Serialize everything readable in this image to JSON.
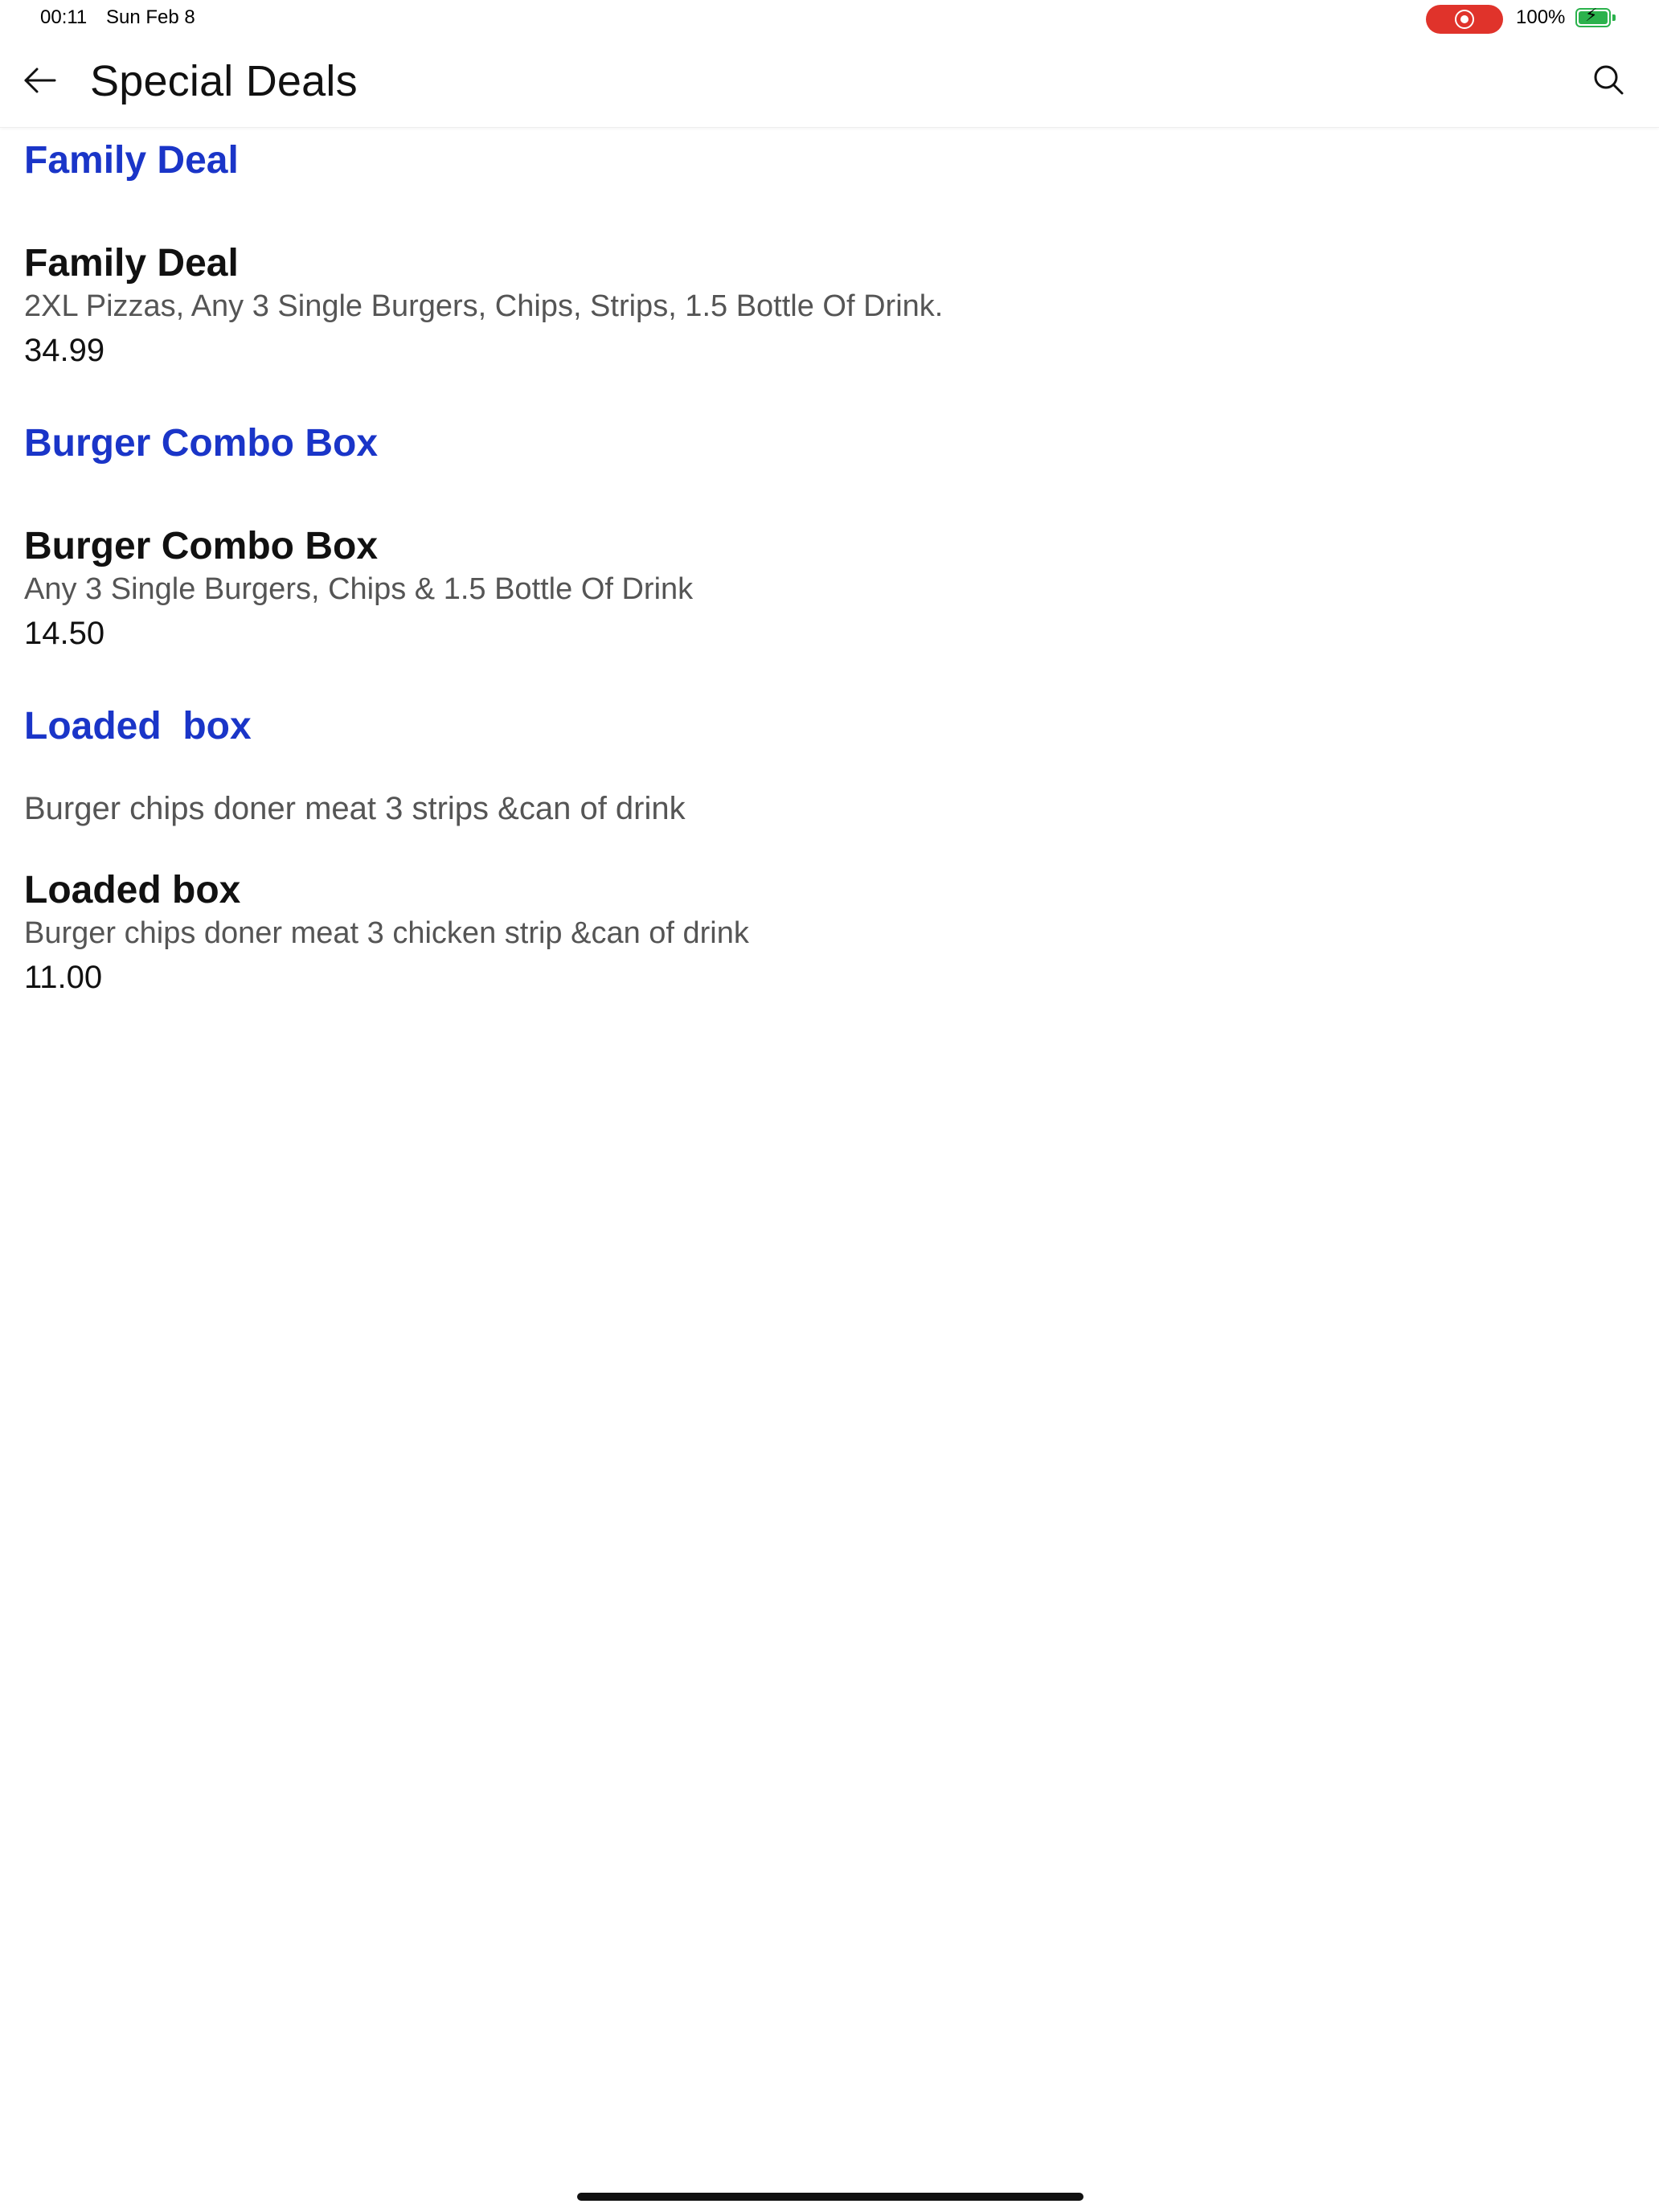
{
  "status_bar": {
    "time": "00:11",
    "date": "Sun Feb 8",
    "battery_percent": "100%",
    "recording_color": "#e0332b",
    "battery_color": "#2bb24c"
  },
  "header": {
    "title": "Special Deals",
    "back_icon": "arrow-left-icon",
    "search_icon": "search-icon"
  },
  "accent_color": "#1a35c8",
  "categories": [
    {
      "title": "Family Deal",
      "items": [
        {
          "name": "Family Deal",
          "description": "2XL Pizzas, Any 3 Single Burgers, Chips, Strips, 1.5 Bottle Of Drink.",
          "price": "34.99"
        }
      ]
    },
    {
      "title": "Burger Combo Box",
      "items": [
        {
          "name": "Burger Combo Box",
          "description": "Any 3 Single Burgers, Chips & 1.5 Bottle Of Drink",
          "price": "14.50"
        }
      ]
    },
    {
      "title": "Loaded  box",
      "description": "Burger chips doner meat 3 strips &can of drink",
      "items": [
        {
          "name": "Loaded box",
          "description": "Burger chips doner meat 3 chicken strip &can of drink",
          "price": "11.00"
        }
      ]
    }
  ]
}
